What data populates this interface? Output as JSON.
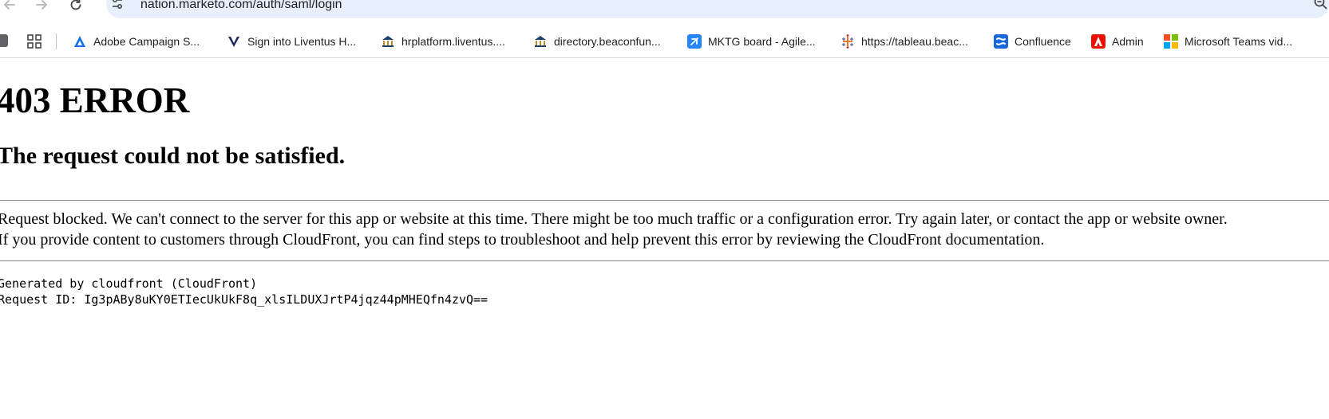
{
  "browser": {
    "url": "nation.marketo.com/auth/saml/login",
    "bookmarks": [
      {
        "label": "Adobe Campaign S...",
        "icon": "adobe-campaign-icon"
      },
      {
        "label": "Sign into Liventus H...",
        "icon": "liventus-icon"
      },
      {
        "label": "hrplatform.liventus....",
        "icon": "building-icon"
      },
      {
        "label": "directory.beaconfun...",
        "icon": "building-icon"
      },
      {
        "label": "MKTG board - Agile...",
        "icon": "jira-icon"
      },
      {
        "label": "https://tableau.beac...",
        "icon": "tableau-icon"
      },
      {
        "label": "Confluence",
        "icon": "confluence-icon"
      },
      {
        "label": "Admin",
        "icon": "adobe-admin-icon"
      },
      {
        "label": "Microsoft Teams vid...",
        "icon": "microsoft-icon"
      }
    ]
  },
  "page": {
    "title": "403 ERROR",
    "subtitle": "The request could not be satisfied.",
    "message_line1": "Request blocked. We can't connect to the server for this app or website at this time. There might be too much traffic or a configuration error. Try again later, or contact the app or website owner.",
    "message_line2": "If you provide content to customers through CloudFront, you can find steps to troubleshoot and help prevent this error by reviewing the CloudFront documentation.",
    "generated_by": "Generated by cloudfront (CloudFront)",
    "request_id": "Request ID: Ig3pABy8uKY0ETIecUkUkF8q_xlsILDUXJrtP4jqz44pMHEQfn4zvQ=="
  },
  "colors": {
    "omnibox_bg": "#e8f0fe",
    "jira_blue": "#2684ff",
    "confluence_blue": "#1868db",
    "adobe_red": "#eb1000"
  }
}
